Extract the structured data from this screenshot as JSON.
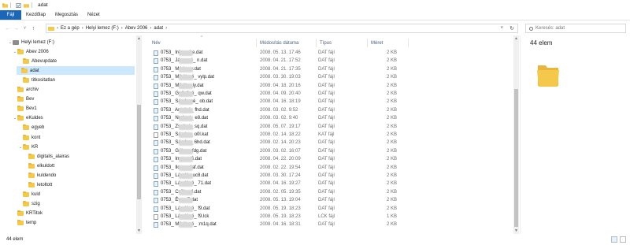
{
  "window": {
    "title": "adat"
  },
  "ribbon": {
    "tabs": [
      "Fájl",
      "Kezdőlap",
      "Megosztás",
      "Nézet"
    ]
  },
  "address": {
    "crumbs": [
      "Ez a gép",
      "Helyi lemez (F:)",
      "Abev 2006",
      "adat"
    ]
  },
  "search": {
    "placeholder": "Keresés: adat"
  },
  "tree": [
    {
      "label": "Helyi lemez (F:)",
      "kind": "drive",
      "expanded": true
    },
    {
      "label": "Abev 2006",
      "expanded": true
    },
    {
      "label": "Abevupdate"
    },
    {
      "label": "adat",
      "selected": true
    },
    {
      "label": "titkositatlan"
    },
    {
      "label": "archiv"
    },
    {
      "label": "Bev"
    },
    {
      "label": "Bev1"
    },
    {
      "label": "eKuldes",
      "expanded": true
    },
    {
      "label": "egyeb"
    },
    {
      "label": "kont"
    },
    {
      "label": "KR",
      "expanded": true
    },
    {
      "label": "digitalis_alairas"
    },
    {
      "label": "elkuldott"
    },
    {
      "label": "kuldendo"
    },
    {
      "label": "letoltott"
    },
    {
      "label": "kuld"
    },
    {
      "label": "szig"
    },
    {
      "label": "KRTitok"
    },
    {
      "label": "temp"
    }
  ],
  "columns": {
    "name": "Név",
    "date": "Módosítás dátuma",
    "type": "Típus",
    "size": "Méret"
  },
  "files": [
    {
      "name": "0753_         Irén_           uke.dat",
      "date": "2008. 05. 13. 17:46",
      "type": "DAT fájl",
      "size": "2 KB"
    },
    {
      "name": "0753_        Jánosné_          n.dat",
      "date": "2008. 04. 21. 17:52",
      "type": "DAT fájl",
      "size": "2 KB"
    },
    {
      "name": "0753_        Mária_            y.dat",
      "date": "2008. 04. 21. 17:35",
      "type": "DAT fájl",
      "size": "2 KB"
    },
    {
      "name": "0753_        Mihályné_        vylp.dat",
      "date": "2008. 03. 30. 19:03",
      "type": "DAT fájl",
      "size": "2 KB"
    },
    {
      "name": "0753_        Mihály_           ly.dat",
      "date": "2008. 04. 18. 20:16",
      "type": "DAT fájl",
      "size": "2 KB"
    },
    {
      "name": "0753_        Győzőné_        qw.dat",
      "date": "2008. 04. 09. 20:40",
      "type": "DAT fájl",
      "size": "2 KB"
    },
    {
      "name": "0753_        Sándorné_         ob.dat",
      "date": "2008. 04. 16. 18:19",
      "type": "DAT fájl",
      "size": "2 KB"
    },
    {
      "name": "0753_        Antalné_         fhd.dat",
      "date": "2008. 03. 02. 9:52",
      "type": "DAT fájl",
      "size": "2 KB"
    },
    {
      "name": "0753_        Norbert_          e8.dat",
      "date": "2008. 03. 02. 9:40",
      "type": "DAT fájl",
      "size": "2 KB"
    },
    {
      "name": "0753_        Zsoltné_          sq.dat",
      "date": "2008. 05. 07. 19:17",
      "type": "DAT fájl",
      "size": "2 KB"
    },
    {
      "name": "0753_        Sándor_          o0l.kat",
      "date": "2008. 02. 14. 18:22",
      "type": "KAT fájl",
      "size": "2 KB"
    },
    {
      "name": "0753_        Sándor_          6hd.dat",
      "date": "2008. 02. 14. 20:23",
      "type": "DAT fájl",
      "size": "2 KB"
    },
    {
      "name": "0753_        Gábor_           fdg.dat",
      "date": "2009. 03. 02. 16:07",
      "type": "DAT fájl",
      "size": "2 KB"
    },
    {
      "name": "0753_        Imre_            p6.dat",
      "date": "2008. 04. 22. 20:09",
      "type": "DAT fájl",
      "size": "2 KB"
    },
    {
      "name": "0753_        Ilona_           4af.dat",
      "date": "2008. 02. 22. 19:54",
      "type": "DAT fájl",
      "size": "2 KB"
    },
    {
      "name": "0753_        László_          uc8.dat",
      "date": "2008. 03. 30. 17:24",
      "type": "DAT fájl",
      "size": "2 KB"
    },
    {
      "name": "0753_        Lászlóné_       71.dat",
      "date": "2008. 04. 16. 19:27",
      "type": "DAT fájl",
      "size": "2 KB"
    },
    {
      "name": "0753_        Csilla_           4.dat",
      "date": "2008. 02. 05. 19:35",
      "type": "DAT fájl",
      "size": "2 KB"
    },
    {
      "name": "0753_        Éva_              7.dat",
      "date": "2008. 05. 13. 19:04",
      "type": "DAT fájl",
      "size": "2 KB"
    },
    {
      "name": "0753_        Lászlóné_         f9.dat",
      "date": "2008. 05. 19. 18:23",
      "type": "DAT fájl",
      "size": "2 KB"
    },
    {
      "name": "0753_        Lászlóné_        f9.lck",
      "date": "2008. 05. 19. 18:23",
      "type": "LCK fájl",
      "size": "1 KB"
    },
    {
      "name": "0753_        Mihályné_        :m1q.dat",
      "date": "2008. 04. 16. 18:31",
      "type": "DAT fájl",
      "size": "2 KB"
    }
  ],
  "preview": {
    "count": "44 elem"
  },
  "status": {
    "count": "44 elem"
  },
  "colors": {
    "accent": "#1b67b7",
    "selection": "#cce8ff",
    "folder": "#f3c84b"
  }
}
